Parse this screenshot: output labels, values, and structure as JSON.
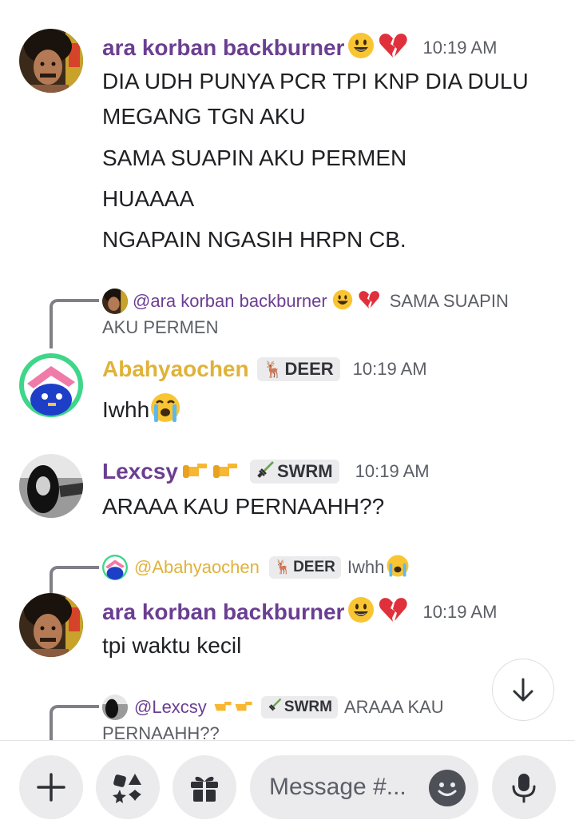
{
  "messages": [
    {
      "username": "ara korban backburner",
      "time": "10:19 AM",
      "lines": [
        "DIA UDH PUNYA PCR TPI KNP DIA DULU",
        "MEGANG TGN AKU",
        "SAMA SUAPIN AKU PERMEN",
        "HUAAAA",
        "NGAPAIN NGASIH HRPN CB."
      ]
    },
    {
      "reply": {
        "mention": "@ara korban backburner",
        "text1": "SAMA SUAPIN",
        "text2": "AKU PERMEN"
      },
      "username": "Abahyaochen",
      "tag": "DEER",
      "time": "10:19 AM",
      "text": "Iwhh"
    },
    {
      "username": "Lexcsy",
      "tag": "SWRM",
      "time": "10:19 AM",
      "text": "ARAAA KAU PERNAAHH??"
    },
    {
      "reply": {
        "mention": "@Abahyaochen",
        "tag": "DEER",
        "text": "Iwhh"
      },
      "username": "ara korban backburner",
      "time": "10:19 AM",
      "text": "tpi waktu kecil"
    },
    {
      "reply": {
        "mention": "@Lexcsy",
        "tag": "SWRM",
        "text1": "ARAAA KAU",
        "text2": "PERNAAHH??"
      }
    }
  ],
  "input": {
    "placeholder": "Message #..."
  },
  "colors": {
    "purple": "#6b3e92",
    "gold": "#e0b23a",
    "bar": "#ebebed"
  }
}
